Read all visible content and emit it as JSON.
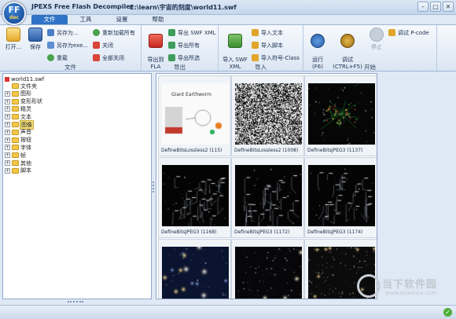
{
  "window": {
    "app_title": "JPEXS Free Flash Decompiler",
    "file_path": "E:\\learn\\宇宙的刻度\\world11.swf",
    "logo_text": "FF",
    "logo_sub": "dec",
    "minimize_glyph": "–",
    "maximize_glyph": "□",
    "close_glyph": "✕"
  },
  "tabs": [
    {
      "label": "文件",
      "active": true
    },
    {
      "label": "工具",
      "active": false
    },
    {
      "label": "设置",
      "active": false
    },
    {
      "label": "帮助",
      "active": false
    }
  ],
  "ribbon": {
    "file": {
      "label": "文件",
      "open": "打开...",
      "save": "保存",
      "save_as": "另存为...",
      "save_as_exe": "另存为exe...",
      "reload": "重载",
      "reload_all": "重新加载所有",
      "close": "关闭",
      "close_all": "全部关闭"
    },
    "export": {
      "label": "导出",
      "export_fla": "导出到\nFLA",
      "export_swf_xml": "导出 SWF XML",
      "export_all": "导出所有",
      "export_selected": "导出所选"
    },
    "import": {
      "label": "导入",
      "import_swf_xml": "导入 SWF\nXML",
      "import_text": "导入文本",
      "import_script": "导入脚本",
      "import_symbol_class": "导入符号-Class"
    },
    "start": {
      "label": "开始",
      "run": "运行\n(F6)",
      "debug": "调试\n(CTRL+F5)",
      "stop": "停止",
      "debug_pcode": "调试 P-code"
    }
  },
  "tree": {
    "root": "world11.swf",
    "items": [
      {
        "label": "文件夹",
        "expandable": false,
        "selected": false
      },
      {
        "label": "图形",
        "expandable": true,
        "selected": false
      },
      {
        "label": "变形形状",
        "expandable": true,
        "selected": false
      },
      {
        "label": "精灵",
        "expandable": true,
        "selected": false
      },
      {
        "label": "文本",
        "expandable": true,
        "selected": false
      },
      {
        "label": "图像",
        "expandable": true,
        "selected": true
      },
      {
        "label": "声音",
        "expandable": true,
        "selected": false
      },
      {
        "label": "按钮",
        "expandable": true,
        "selected": false
      },
      {
        "label": "字体",
        "expandable": true,
        "selected": false
      },
      {
        "label": "帧",
        "expandable": true,
        "selected": false
      },
      {
        "label": "其他",
        "expandable": true,
        "selected": false
      },
      {
        "label": "脚本",
        "expandable": true,
        "selected": false
      }
    ]
  },
  "thumbnails": [
    {
      "caption": "DefineBitsLossless2 (115)",
      "kind": "diagram",
      "overlay_text": "Giant Earthworm"
    },
    {
      "caption": "DefineBitsLossless2 (1008)",
      "kind": "noise"
    },
    {
      "caption": "DefineBitsJPEG3 (1137)",
      "kind": "dark-green"
    },
    {
      "caption": "DefineBitsJPEG3 (1168)",
      "kind": "dark-lines"
    },
    {
      "caption": "DefineBitsJPEG3 (1172)",
      "kind": "dark-lines"
    },
    {
      "caption": "DefineBitsJPEG3 (1174)",
      "kind": "dark-lines"
    },
    {
      "caption": "",
      "kind": "galaxy-blue"
    },
    {
      "caption": "",
      "kind": "galaxy-dark"
    },
    {
      "caption": "",
      "kind": "galaxy-stars"
    }
  ],
  "watermark": {
    "text": "当下软件园",
    "url": "www.downxia.com"
  },
  "colors": {
    "accent": "#2f73c6",
    "selection": "#f5e27a",
    "status_ok": "#4caf3a"
  }
}
